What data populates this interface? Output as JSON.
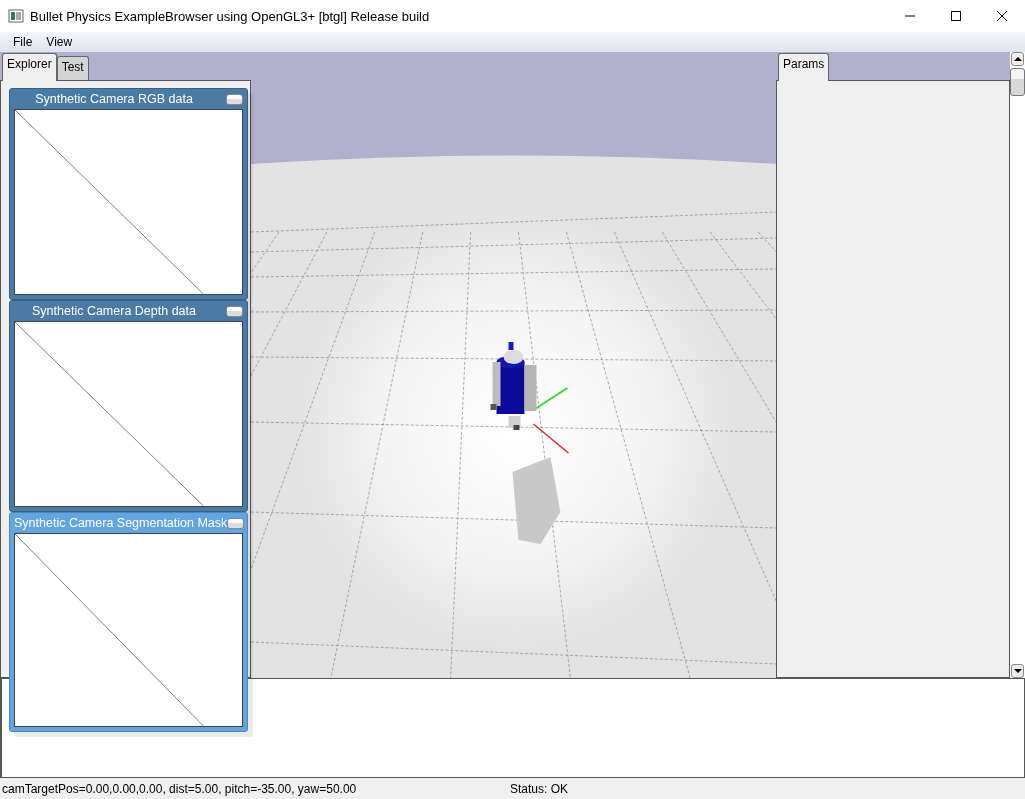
{
  "window": {
    "title": "Bullet Physics ExampleBrowser using OpenGL3+ [btgl] Release build"
  },
  "menu": [
    {
      "label": "File"
    },
    {
      "label": "View"
    }
  ],
  "explorer_tabs": [
    {
      "label": "Explorer",
      "selected": true
    },
    {
      "label": "Test",
      "selected": false
    }
  ],
  "camera_windows": [
    {
      "title": "Synthetic Camera RGB data",
      "active": false
    },
    {
      "title": "Synthetic Camera Depth data",
      "active": false
    },
    {
      "title": "Synthetic Camera Segmentation Mask",
      "active": true
    }
  ],
  "params_tabs": [
    {
      "label": "Params",
      "selected": true
    }
  ],
  "status_bar": {
    "camera": "camTargetPos=0.00,0.00,0.00, dist=5.00, pitch=-35.00, yaw=50.00",
    "status": "Status: OK"
  }
}
